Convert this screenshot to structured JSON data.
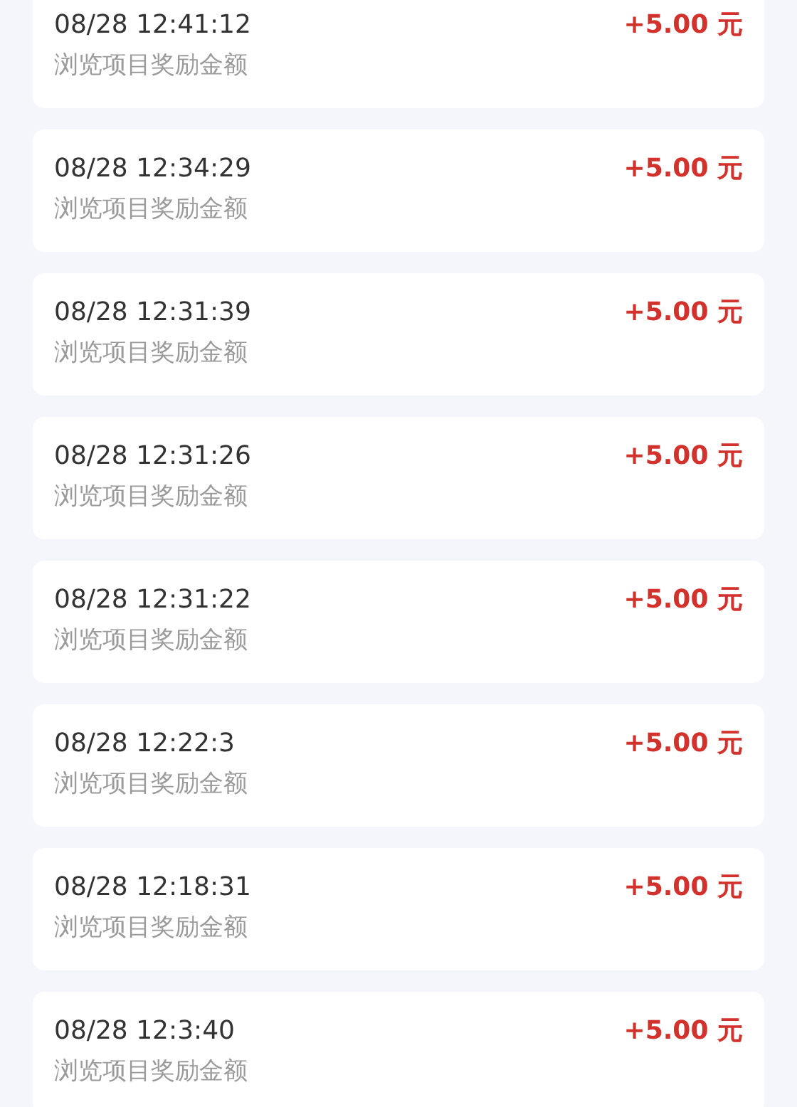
{
  "records": [
    {
      "time": "08/28 12:41:12",
      "description": "浏览项目奖励金额",
      "amount": "+5.00 元"
    },
    {
      "time": "08/28 12:34:29",
      "description": "浏览项目奖励金额",
      "amount": "+5.00 元"
    },
    {
      "time": "08/28 12:31:39",
      "description": "浏览项目奖励金额",
      "amount": "+5.00 元"
    },
    {
      "time": "08/28 12:31:26",
      "description": "浏览项目奖励金额",
      "amount": "+5.00 元"
    },
    {
      "time": "08/28 12:31:22",
      "description": "浏览项目奖励金额",
      "amount": "+5.00 元"
    },
    {
      "time": "08/28 12:22:3",
      "description": "浏览项目奖励金额",
      "amount": "+5.00 元"
    },
    {
      "time": "08/28 12:18:31",
      "description": "浏览项目奖励金额",
      "amount": "+5.00 元"
    },
    {
      "time": "08/28 12:3:40",
      "description": "浏览项目奖励金额",
      "amount": "+5.00 元"
    }
  ]
}
